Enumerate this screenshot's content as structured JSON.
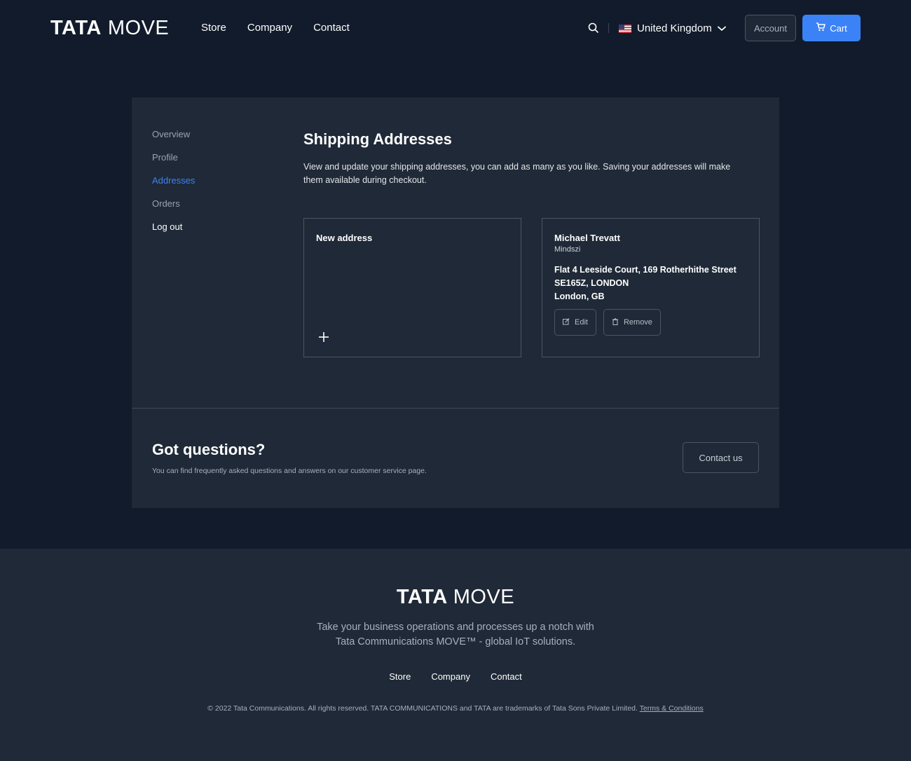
{
  "header": {
    "logo": {
      "bold": "TATA",
      "light": "MOVE"
    },
    "nav": [
      "Store",
      "Company",
      "Contact"
    ],
    "country": "United Kingdom",
    "account_label": "Account",
    "cart_label": "Cart",
    "icons": {
      "search": "search-icon",
      "flag": "us-flag-icon",
      "chevron": "chevron-down-icon",
      "cart": "cart-icon"
    }
  },
  "sidebar": {
    "items": [
      {
        "label": "Overview"
      },
      {
        "label": "Profile"
      },
      {
        "label": "Addresses",
        "active": true
      },
      {
        "label": "Orders"
      },
      {
        "label": "Log out"
      }
    ]
  },
  "main": {
    "title": "Shipping Addresses",
    "description": "View and update your shipping addresses, you can add as many as you like. Saving your addresses will make them available during checkout.",
    "new_address_label": "New address",
    "address": {
      "name": "Michael Trevatt",
      "company": "Mindszi",
      "line1": "Flat 4 Leeside Court, 169 Rotherhithe Street",
      "line2": "SE165Z, LONDON",
      "line3": "London, GB",
      "edit_label": "Edit",
      "remove_label": "Remove"
    }
  },
  "questions": {
    "title": "Got questions?",
    "description": "You can find frequently asked questions and answers on our customer service page.",
    "button_label": "Contact us"
  },
  "footer": {
    "logo": {
      "bold": "TATA",
      "light": "MOVE"
    },
    "tagline_line1": "Take your business operations and processes up a notch with",
    "tagline_line2": "Tata Communications MOVE™ - global IoT solutions.",
    "nav": [
      "Store",
      "Company",
      "Contact"
    ],
    "copyright": "© 2022 Tata Communications. All rights reserved. TATA COMMUNICATIONS and TATA are trademarks of Tata Sons Private Limited.",
    "terms_label": "Terms & Conditions"
  },
  "colors": {
    "background": "#111b2b",
    "panel": "#1f2937",
    "accent": "#3b82f6"
  }
}
